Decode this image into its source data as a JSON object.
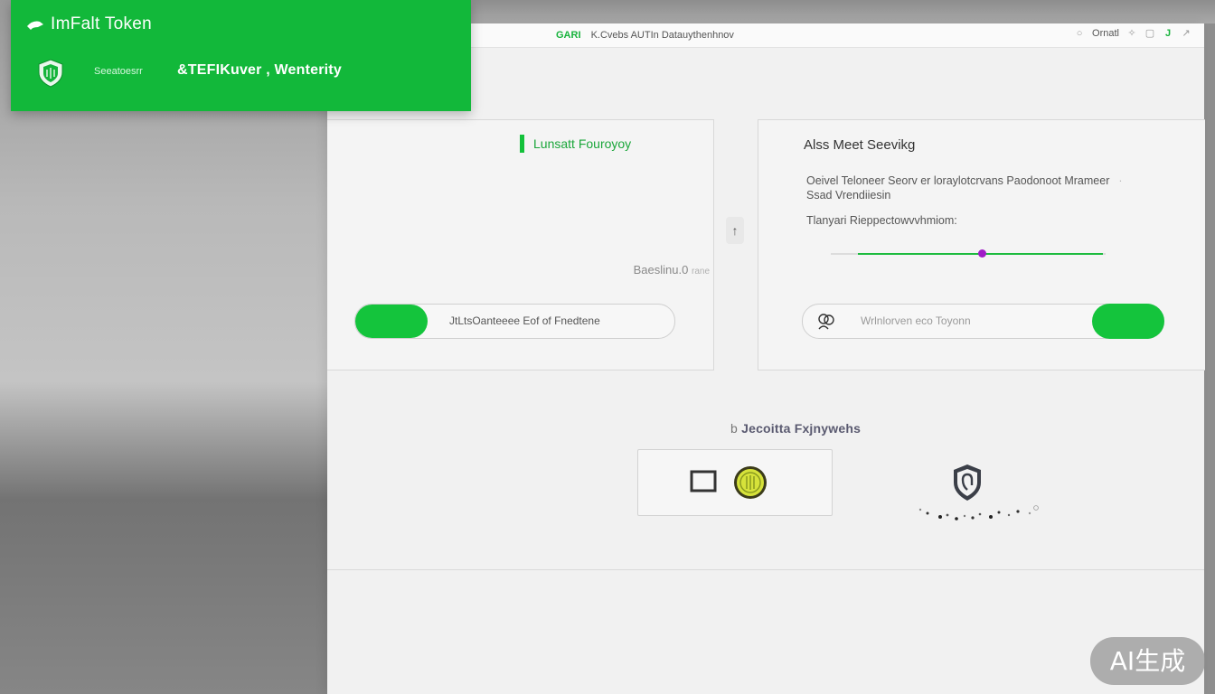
{
  "window": {
    "title_brand": "GARI",
    "title_text": "K.Cvebs  AUTIn Datauythenhnov",
    "right_label": "Ornatl"
  },
  "overlay": {
    "app_title": "ImFalt Token",
    "small_label": "Seeatoesrr",
    "big_label": "&TEFIKuver , Wenterity"
  },
  "left_card": {
    "heading": "Lunsatt Fouroyoy",
    "note": "Baeslinu.0",
    "note_small": "rane",
    "button_label": "JtLtsOanteeee Eof  of  Fnedtene"
  },
  "right_card": {
    "title": "Alss Meet Seevikg",
    "desc_line1": "Oeivel Teloneer Seorv er loraylotcrvans  Paodonoot Mrameer",
    "desc_line2": "Ssad Vrendiiesin",
    "subtitle": "Tlanyari Rieppectowvvhmiom:",
    "slider_fill_start": 0.1,
    "slider_value": 0.55,
    "input_placeholder": "Wrlnlorven eco Toyonn"
  },
  "section": {
    "label_prefix": "b",
    "label_text": "Jecoitta Fxjnywehs"
  },
  "watermark": "AI生成",
  "colors": {
    "brand_green": "#13c13a",
    "slider_thumb": "#a01dc7"
  },
  "icons": [
    "back-arrow-icon",
    "shield-icon",
    "arrow-up-icon",
    "people-icon",
    "square-icon",
    "coin-icon",
    "security-shield-icon"
  ]
}
